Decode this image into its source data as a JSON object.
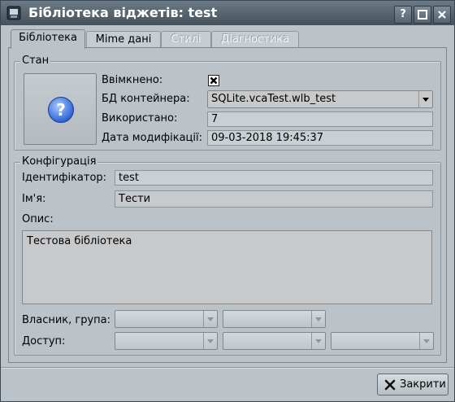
{
  "window": {
    "title": "Бібліотека віджетів: test",
    "buttons": {
      "help": "?",
      "maximize": "□",
      "close": "✕"
    }
  },
  "tabs": [
    {
      "label": "Бібліотека",
      "active": true,
      "enabled": true
    },
    {
      "label": "Mime дані",
      "active": false,
      "enabled": true
    },
    {
      "label": "Стилі",
      "active": false,
      "enabled": false
    },
    {
      "label": "Діагностика",
      "active": false,
      "enabled": false
    }
  ],
  "state": {
    "title": "Стан",
    "icon": "help-question-icon",
    "enabled_label": "Ввімкнено:",
    "enabled_value": true,
    "db_label": "БД контейнера:",
    "db_value": "SQLite.vcaTest.wlb_test",
    "used_label": "Використано:",
    "used_value": "7",
    "modified_label": "Дата модифікації:",
    "modified_value": "09-03-2018 19:45:37"
  },
  "config": {
    "title": "Конфігурація",
    "id_label": "Ідентифікатор:",
    "id_value": "test",
    "name_label": "Ім'я:",
    "name_value": "Тести",
    "desc_label": "Опис:",
    "desc_value": "Тестова бібліотека",
    "owner_label": "Власник, група:",
    "access_label": "Доступ:"
  },
  "footer": {
    "close_label": "Закрити",
    "close_icon": "close-x-icon"
  }
}
